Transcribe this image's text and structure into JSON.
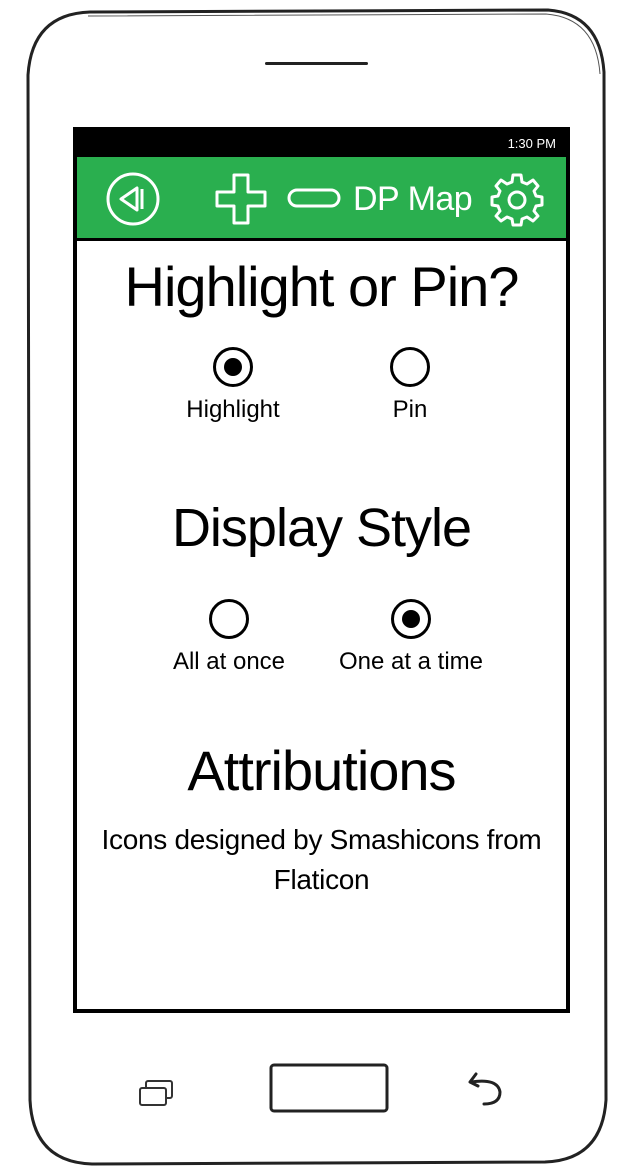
{
  "status_bar": {
    "time": "1:30 PM"
  },
  "app_bar": {
    "title": "DP Map",
    "icons": [
      "back-icon",
      "zoom-in-icon",
      "zoom-out-icon",
      "settings-icon"
    ],
    "background_color": "#2aaf4f"
  },
  "sections": {
    "highlight_or_pin": {
      "title": "Highlight or Pin?",
      "options": [
        {
          "label": "Highlight",
          "selected": true
        },
        {
          "label": "Pin",
          "selected": false
        }
      ]
    },
    "display_style": {
      "title": "Display Style",
      "options": [
        {
          "label": "All at once",
          "selected": false
        },
        {
          "label": "One at a time",
          "selected": true
        }
      ]
    },
    "attributions": {
      "title": "Attributions",
      "text": "Icons designed by Smashicons from Flaticon"
    }
  },
  "nav_bar": {
    "icons": [
      "recent-apps-icon",
      "home-button",
      "back-nav-icon"
    ]
  }
}
